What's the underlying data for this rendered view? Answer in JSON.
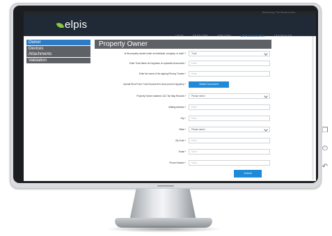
{
  "site": {
    "top_note": "Welcoming, The Western Area",
    "logo_text": "elpis",
    "nav": [
      "HOME",
      "PRODUCTS",
      "SERVICES",
      "ARE ASSOCIATES",
      "ABOUT ELPIS"
    ],
    "nav_active_index": 3
  },
  "sidebar": {
    "items": [
      "Owner",
      "Devices",
      "Attachments",
      "Validation"
    ],
    "active_index": 0
  },
  "page_title": "Property Owner",
  "form": {
    "owner_type": {
      "label": "Is the property owned under an individual, company, or trust? *",
      "value": "Trust"
    },
    "trust_name": {
      "label": "Enter Trust Name as it appears on uploaded documents *",
      "placeholder": "Enter"
    },
    "trustee_name": {
      "label": "Enter the name of the signing Primary Trustee *",
      "placeholder": "Enter"
    },
    "upload": {
      "label": "Upload Short Form Trust Document to show proof of signatory *",
      "button": "Attach Document"
    },
    "tax_match": {
      "label": "Property Owner matches C&C Tax Map Records *",
      "value": "Please select"
    },
    "mailing": {
      "label": "Mailing Address *",
      "placeholder": "Enter"
    },
    "city": {
      "label": "City *",
      "placeholder": "Enter"
    },
    "state": {
      "label": "State *",
      "value": "Please select"
    },
    "zip": {
      "label": "Zip Code *",
      "placeholder": "Enter"
    },
    "email": {
      "label": "Email *",
      "placeholder": "Enter"
    },
    "phone": {
      "label": "Phone Number *",
      "placeholder": "Enter"
    },
    "submit": "Submit"
  },
  "colors": {
    "accent": "#1f8ad8",
    "header_bg": "#1f2a36",
    "sidebar_bg": "#5e6166",
    "logo_leaf": "#8cc63f"
  },
  "device_icons": [
    "copy-icon",
    "power-icon",
    "back-icon"
  ]
}
